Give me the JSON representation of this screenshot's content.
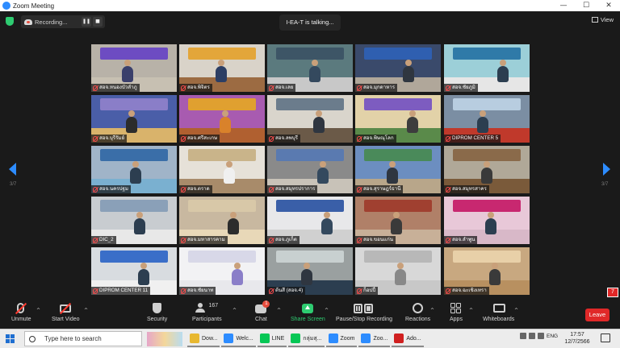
{
  "window": {
    "title": "Zoom Meeting",
    "controls": [
      "—",
      "☐",
      "✕"
    ]
  },
  "recording": {
    "label": "Recording..."
  },
  "talking": {
    "label": "I-EA-T is talking..."
  },
  "view": {
    "label": "View"
  },
  "pagination": {
    "left": "3/7",
    "right": "3/7"
  },
  "tiles": [
    {
      "name": "สอจ.หนองบัวลำภู",
      "bg": "#b8b2a8",
      "banner": "#6d4cc2",
      "desk": "#c7c0b2",
      "person": "#3a3f6b"
    },
    {
      "name": "สอจ.พิจิตร",
      "bg": "#d9d3c9",
      "banner": "#e3a63a",
      "desk": "#9c6b42",
      "person": "#2c3e64"
    },
    {
      "name": "สอจ.เลย",
      "bg": "#5b7a7e",
      "banner": "#3d5566",
      "desk": "#c8c8c8",
      "person": "#34495e"
    },
    {
      "name": "สอจ.มุกดาหาร",
      "bg": "#3a4a6b",
      "banner": "#2f5fb0",
      "desk": "#b0a79a",
      "person": "#2f3640"
    },
    {
      "name": "สอจ.ชัยภูมิ",
      "bg": "#9ccfd8",
      "banner": "#2f7aa8",
      "desk": "#e6e6e6",
      "person": "#2c3e50"
    },
    {
      "name": "สอจ.บุรีรัมย์",
      "bg": "#4a5ea8",
      "banner": "#8a7ec8",
      "desk": "#d9b36b",
      "person": "#2c2c2c"
    },
    {
      "name": "สอจ.ศรีสะเกษ",
      "bg": "#a85bb0",
      "banner": "#e0a030",
      "desk": "#b06030",
      "person": "#d9822b"
    },
    {
      "name": "สอจ.ลพบุรี",
      "bg": "#d9d5cc",
      "banner": "#6b7c8c",
      "desk": "#6b5a48",
      "person": "#2f3640"
    },
    {
      "name": "สอจ.พิษณุโลก",
      "bg": "#e2d2a8",
      "banner": "#7d5cc0",
      "desk": "#5a8a4a",
      "person": "#3d3d3d"
    },
    {
      "name": "DIPROM CENTER 5",
      "bg": "#7b8ea3",
      "banner": "#b8cde0",
      "desk": "#c0392b",
      "person": "#2c3e50"
    },
    {
      "name": "สอจ.นครปฐม",
      "bg": "#a0b4c8",
      "banner": "#3a6ea8",
      "desk": "#7ab0d0",
      "person": "#2c3e50"
    },
    {
      "name": "สอจ.ตราด",
      "bg": "#e6e1d8",
      "banner": "#c9b48a",
      "desk": "#a88b6a",
      "person": "#f0f0f0"
    },
    {
      "name": "สอจ.สมุทรปราการ",
      "bg": "#8a8a8a",
      "banner": "#5a7ab0",
      "desk": "#c8c2b8",
      "person": "#34495e"
    },
    {
      "name": "สอจ.สุราษฎร์ธานี",
      "bg": "#6c8ec0",
      "banner": "#4a8a5a",
      "desk": "#b8a68a",
      "person": "#2f3640"
    },
    {
      "name": "สอจ.สมุทรสาคร",
      "bg": "#b0a898",
      "banner": "#8a6a4a",
      "desk": "#7a5a3a",
      "person": "#3a3a3a"
    },
    {
      "name": "DIC_2",
      "bg": "#c8ccd0",
      "banner": "#8aa0b8",
      "desk": "#e8e8e8",
      "person": "#2c3e50"
    },
    {
      "name": "สอจ.มหาสารคาม",
      "bg": "#c8b8a0",
      "banner": "#d8c8a8",
      "desk": "#e8d8b8",
      "person": "#2c2c2c"
    },
    {
      "name": "สอจ.ภูเก็ต",
      "bg": "#e8e8ea",
      "banner": "#3a5fa8",
      "desk": "#d0d0d0",
      "person": "#34495e"
    },
    {
      "name": "สอจ.ขอนแก่น",
      "bg": "#b08068",
      "banner": "#a04030",
      "desk": "#c8b098",
      "person": "#3a3a3a"
    },
    {
      "name": "สอจ.ลำพูน",
      "bg": "#e8c8d8",
      "banner": "#c82870",
      "desk": "#d8b8c8",
      "person": "#2c3e50"
    },
    {
      "name": "DIPROM CENTER 11",
      "bg": "#d8dce0",
      "banner": "#3a6ec8",
      "desk": "#f0f0f0",
      "person": "#2c3e50"
    },
    {
      "name": "สอจ.ชัยนาท",
      "bg": "#f2f2f4",
      "banner": "#d8d8e8",
      "desk": "#e8e8ec",
      "person": "#8a7ec8"
    },
    {
      "name": "ต้นสี (สอจ.4)",
      "bg": "#9aa0a0",
      "banner": "#c8d0d0",
      "desk": "#2c3e50",
      "person": "#2f3640"
    },
    {
      "name": "ก็อปปี้",
      "bg": "#d8d8d8",
      "banner": "#b8b8b8",
      "desk": "#c8c8c8",
      "person": "#888888"
    },
    {
      "name": "สอจ.ฉะเชิงเทรา",
      "bg": "#c8a880",
      "banner": "#e8d0a8",
      "desk": "#b89060",
      "person": "#3a3a3a"
    }
  ],
  "toolbar": {
    "unmute": "Unmute",
    "start_video": "Start Video",
    "security": "Security",
    "participants": "Participants",
    "participants_count": "167",
    "chat": "Chat",
    "chat_badge": "1",
    "share_screen": "Share Screen",
    "recording": "Pause/Stop Recording",
    "reactions": "Reactions",
    "apps": "Apps",
    "whiteboards": "Whiteboards",
    "leave": "Leave",
    "caret": "^"
  },
  "notification_badge": "7",
  "taskbar": {
    "search_placeholder": "Type here to search",
    "apps": [
      {
        "label": "Dow...",
        "color": "#e8b830"
      },
      {
        "label": "Welc...",
        "color": "#2d8cff"
      },
      {
        "label": "LINE",
        "color": "#06c755"
      },
      {
        "label": "กลุ่มสุ...",
        "color": "#06c755"
      },
      {
        "label": "Zoom",
        "color": "#2d8cff"
      },
      {
        "label": "Zoo...",
        "color": "#2d8cff"
      },
      {
        "label": "Ado...",
        "color": "#d02020"
      }
    ],
    "ime": "ENG",
    "time": "17:57",
    "date": "12/7/2566"
  },
  "colors": {
    "accent": "#2d8cff",
    "danger": "#e02828",
    "share": "#2ecc71",
    "bg": "#1a1a1a"
  }
}
